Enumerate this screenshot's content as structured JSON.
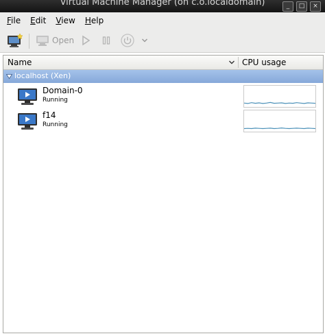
{
  "window": {
    "title": "Virtual Machine Manager (on c.o.localdomain)"
  },
  "window_controls": {
    "minimize": "_",
    "maximize": "□",
    "close": "×"
  },
  "menu": [
    {
      "label": "File",
      "mnemonic": "F",
      "rest": "ile"
    },
    {
      "label": "Edit",
      "mnemonic": "E",
      "rest": "dit"
    },
    {
      "label": "View",
      "mnemonic": "V",
      "rest": "iew"
    },
    {
      "label": "Help",
      "mnemonic": "H",
      "rest": "elp"
    }
  ],
  "toolbar": {
    "open_label": "Open",
    "icons": [
      "new-vm-icon",
      "console-icon",
      "play-icon",
      "pause-icon",
      "power-icon",
      "chevron-down-icon"
    ]
  },
  "table": {
    "columns": {
      "name": "Name",
      "cpu": "CPU usage"
    },
    "group": {
      "label": "localhost (Xen)"
    },
    "rows": [
      {
        "name": "Domain-0",
        "status": "Running",
        "cpu_history": [
          0.12,
          0.1,
          0.14,
          0.11,
          0.13,
          0.1,
          0.12,
          0.15,
          0.11,
          0.12,
          0.13,
          0.1,
          0.12,
          0.11,
          0.14,
          0.12,
          0.1,
          0.13,
          0.12,
          0.11
        ]
      },
      {
        "name": "f14",
        "status": "Running",
        "cpu_history": [
          0.08,
          0.09,
          0.08,
          0.1,
          0.09,
          0.08,
          0.09,
          0.1,
          0.08,
          0.09,
          0.11,
          0.09,
          0.08,
          0.09,
          0.1,
          0.09,
          0.08,
          0.1,
          0.09,
          0.08
        ]
      }
    ]
  },
  "colors": {
    "accent": "#86a8d9",
    "spark_line": "#4a90b8",
    "vm_icon": "#3a78c8"
  }
}
